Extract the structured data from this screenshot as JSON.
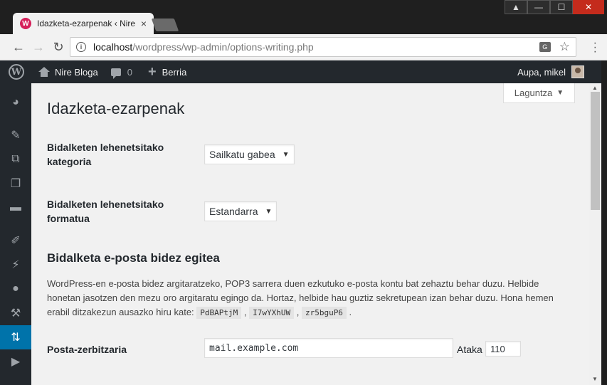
{
  "browser": {
    "tab_title": "Idazketa-ezarpenak ‹ Nire",
    "tab_favicon": "wp-favicon",
    "url_host": "localhost",
    "url_path": "/wordpress/wp-admin/options-writing.php",
    "back_icon": "←",
    "forward_icon": "→",
    "reload_icon": "↻",
    "tab_close": "×",
    "win_min": "—",
    "win_max": "☐",
    "win_close": "✕",
    "win_user": "⯀"
  },
  "adminbar": {
    "site_name": "Nire Bloga",
    "comment_count": "0",
    "new_label": "Berria",
    "greeting": "Aupa, mikel"
  },
  "sidebar": {
    "items": [
      "dashboard-icon",
      "posts-icon",
      "media-icon",
      "pages-icon",
      "comments-icon",
      "appearance-icon",
      "plugins-icon",
      "users-icon",
      "tools-icon",
      "settings-icon",
      "media-play-icon"
    ],
    "active": "settings-icon"
  },
  "page": {
    "help_label": "Laguntza",
    "title": "Idazketa-ezarpenak",
    "default_category_label_1": "Bidalketen lehenetsitako",
    "default_category_label_2": "kategoria",
    "default_category_value": "Sailkatu gabea",
    "default_format_label_1": "Bidalketen lehenetsitako",
    "default_format_label_2": "formatua",
    "default_format_value": "Estandarra",
    "post_via_email_title": "Bidalketa e-posta bidez egitea",
    "desc_1": "WordPress-en e-posta bidez argitaratzeko, POP3 sarrera duen ezkutuko e-posta kontu bat zehaztu behar duzu. Helbide honetan jasotzen den mezu oro argitaratu egingo da. Hortaz, helbide hau guztiz sekretupean izan behar duzu. Hona hemen erabil ditzakezun ausazko hiru kate: ",
    "random_strings": [
      "PdBAPtjM",
      "I7wYXhUW",
      "zr5bguP6"
    ],
    "mail_server_label": "Posta-zerbitzaria",
    "mail_server_value": "mail.example.com",
    "port_label": "Ataka",
    "port_value": "110"
  }
}
